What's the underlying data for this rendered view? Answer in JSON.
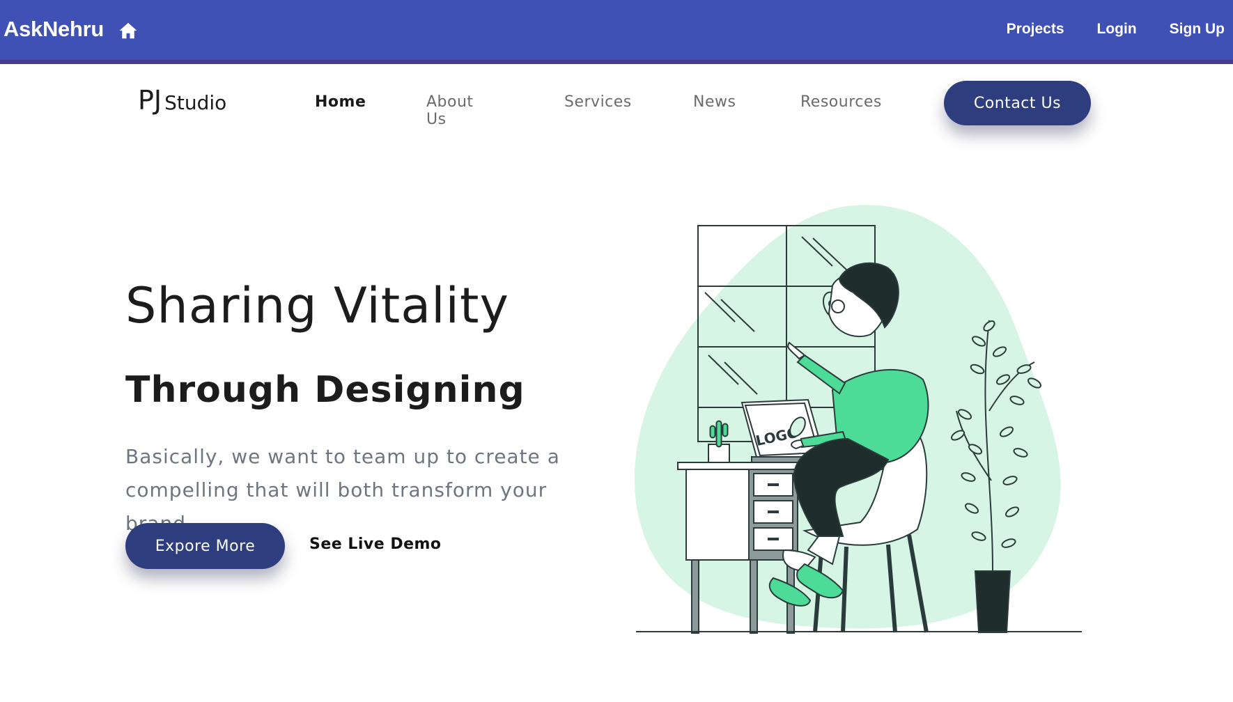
{
  "appbar": {
    "brand": "AskNehru",
    "home_icon": "home-icon",
    "links": [
      "Projects",
      "Login",
      "Sign Up"
    ],
    "background": "#3f51b5"
  },
  "site": {
    "logo_mark": "PJ",
    "logo_text": "Studio",
    "nav": {
      "home": "Home",
      "about": "About Us",
      "services": "Services",
      "news": "News",
      "resources": "Resources"
    },
    "contact_label": "Contact Us",
    "accent": "#2e3d7e"
  },
  "hero": {
    "title": "Sharing Vitality",
    "subtitle": "Through Designing",
    "description": "Basically, we want to team up to create a compelling that will both transform your brand.",
    "primary_cta": "Expore More",
    "secondary_cta": "See Live Demo"
  },
  "illustration": {
    "icon": "person-working-at-desk-illustration",
    "screen_text": "LOGO",
    "mint": "#d6f5e4",
    "green": "#4ddc97"
  }
}
